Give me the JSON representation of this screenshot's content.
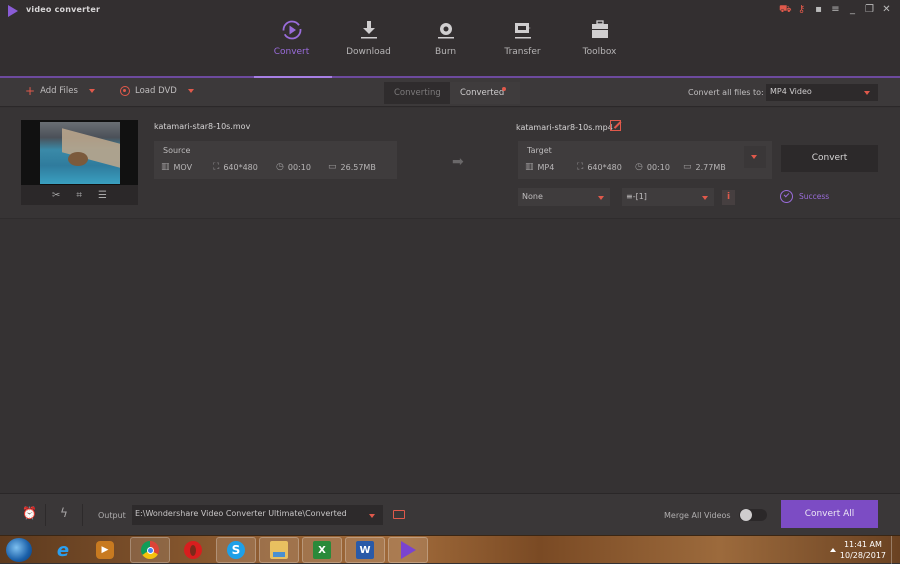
{
  "app": {
    "title": "video converter",
    "accent_color": "#7c4cc4",
    "warning_color": "#e0594b"
  },
  "window_controls": [
    {
      "name": "cart-icon",
      "glyph": "🛒"
    },
    {
      "name": "key-icon",
      "glyph": "⚲"
    },
    {
      "name": "feedback-icon",
      "glyph": "▤"
    },
    {
      "name": "menu-icon",
      "glyph": "≡"
    },
    {
      "name": "minimize-icon",
      "glyph": "_"
    },
    {
      "name": "restore-icon",
      "glyph": "❐"
    },
    {
      "name": "close-icon",
      "glyph": "✕"
    }
  ],
  "nav": {
    "items": [
      {
        "label": "Convert",
        "icon": "convert-icon",
        "active": true
      },
      {
        "label": "Download",
        "icon": "download-icon",
        "active": false
      },
      {
        "label": "Burn",
        "icon": "burn-icon",
        "active": false
      },
      {
        "label": "Transfer",
        "icon": "transfer-icon",
        "active": false
      },
      {
        "label": "Toolbox",
        "icon": "toolbox-icon",
        "active": false
      }
    ]
  },
  "toolbar": {
    "add_files": "Add Files",
    "load_dvd": "Load DVD",
    "tabs": {
      "converting": "Converting",
      "converted": "Converted"
    },
    "convert_all_label": "Convert all files to:",
    "format_value": "MP4 Video"
  },
  "file": {
    "source_name": "katamari-star8-10s.mov",
    "source": {
      "header": "Source",
      "format": "MOV",
      "resolution": "640*480",
      "duration": "00:10",
      "size": "26.57MB"
    },
    "target_name": "katamari-star8-10s.mp4",
    "target": {
      "header": "Target",
      "format": "MP4",
      "resolution": "640*480",
      "duration": "00:10",
      "size": "2.77MB"
    },
    "subtitle_value": "None",
    "audio_value": "≡-[1]",
    "info_label": "i",
    "convert_label": "Convert",
    "status": "Success"
  },
  "bottom": {
    "output_label": "Output",
    "output_path": "E:\\Wondershare Video Converter Ultimate\\Converted",
    "merge_label": "Merge All Videos",
    "merge_on": false,
    "convert_all_label": "Convert All"
  },
  "taskbar": {
    "apps": [
      {
        "name": "internet-explorer-icon",
        "glyph": "e",
        "color": "#2a8fe0"
      },
      {
        "name": "media-player-icon",
        "glyph": "▶",
        "color": "#e8902a"
      },
      {
        "name": "chrome-icon",
        "glyph": "◉",
        "color": "#3a8a3a"
      },
      {
        "name": "opera-icon",
        "glyph": "O",
        "color": "#d81e1e"
      },
      {
        "name": "skype-icon",
        "glyph": "S",
        "color": "#1ea0e8"
      },
      {
        "name": "file-explorer-icon",
        "glyph": "▭",
        "color": "#e8c060"
      },
      {
        "name": "excel-icon",
        "glyph": "X",
        "color": "#2a8a3a"
      },
      {
        "name": "word-icon",
        "glyph": "W",
        "color": "#2a5aa8"
      },
      {
        "name": "video-converter-icon",
        "glyph": "▶",
        "color": "#6a3ab8"
      }
    ],
    "time": "11:41 AM",
    "date": "10/28/2017"
  }
}
